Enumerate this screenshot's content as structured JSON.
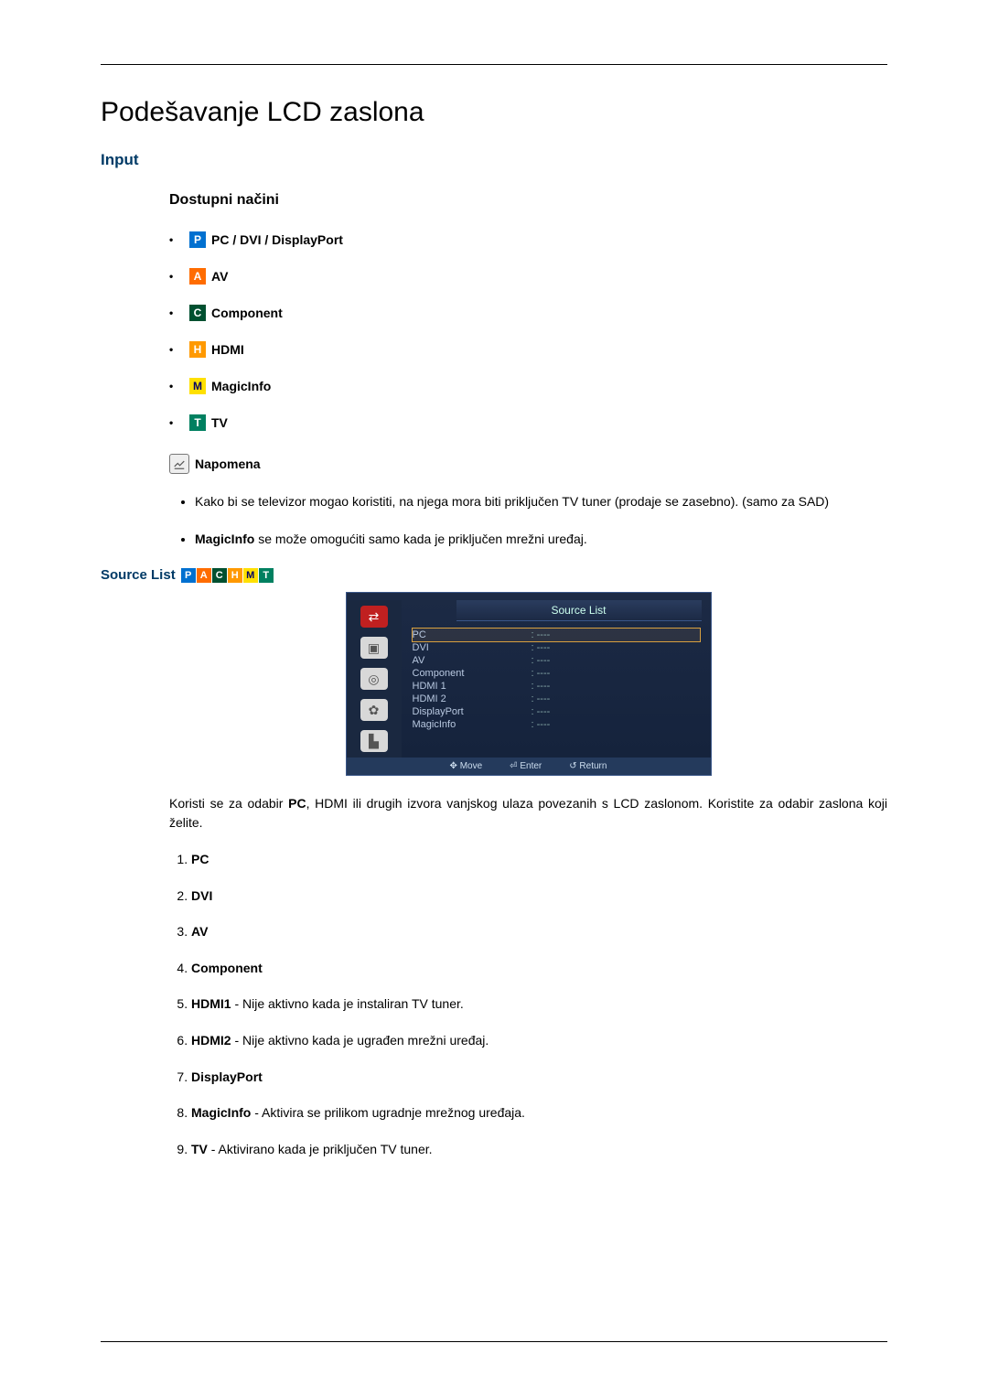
{
  "title": "Podešavanje LCD zaslona",
  "section_input": "Input",
  "sub_modes": "Dostupni načini",
  "modes": {
    "p": {
      "glyph": "P",
      "label": "PC / DVI / DisplayPort"
    },
    "a": {
      "glyph": "A",
      "label": "AV"
    },
    "c": {
      "glyph": "C",
      "label": "Component"
    },
    "h": {
      "glyph": "H",
      "label": "HDMI"
    },
    "m": {
      "glyph": "M",
      "label": "MagicInfo"
    },
    "t": {
      "glyph": "T",
      "label": "TV"
    }
  },
  "note_label": "Napomena",
  "notes": {
    "n1": "Kako bi se televizor mogao koristiti, na njega mora biti priključen TV tuner (prodaje se zasebno). (samo za SAD)",
    "n2_b": "MagicInfo",
    "n2_rest": " se može omogućiti samo kada je priključen mrežni uređaj."
  },
  "source_list_label": "Source List",
  "strip": {
    "p": "P",
    "a": "A",
    "c": "C",
    "h": "H",
    "m": "M",
    "t": "T"
  },
  "osd": {
    "title": "Source List",
    "rows": {
      "r0": {
        "name": "PC",
        "val": ": ----"
      },
      "r1": {
        "name": "DVI",
        "val": ": ----"
      },
      "r2": {
        "name": "AV",
        "val": ": ----"
      },
      "r3": {
        "name": "Component",
        "val": ": ----"
      },
      "r4": {
        "name": "HDMI 1",
        "val": ": ----"
      },
      "r5": {
        "name": "HDMI 2",
        "val": ": ----"
      },
      "r6": {
        "name": "DisplayPort",
        "val": ": ----"
      },
      "r7": {
        "name": "MagicInfo",
        "val": ": ----"
      }
    },
    "foot": {
      "move": "Move",
      "enter": "Enter",
      "ret": "Return"
    }
  },
  "para": {
    "p1a": "Koristi se za odabir ",
    "p1b": "PC",
    "p1c": ", HDMI ili drugih izvora vanjskog ulaza povezanih s LCD zaslonom. Koristite za odabir zaslona koji želite."
  },
  "src": {
    "s1": "PC",
    "s2": "DVI",
    "s3": "AV",
    "s4": "Component",
    "s5b": "HDMI1",
    "s5": " - Nije aktivno kada je instaliran TV tuner.",
    "s6b": "HDMI2",
    "s6": " - Nije aktivno kada je ugrađen mrežni uređaj.",
    "s7": "DisplayPort",
    "s8b": "MagicInfo",
    "s8": " - Aktivira se prilikom ugradnje mrežnog uređaja.",
    "s9b": "TV",
    "s9": " - Aktivirano kada je priključen TV tuner."
  }
}
